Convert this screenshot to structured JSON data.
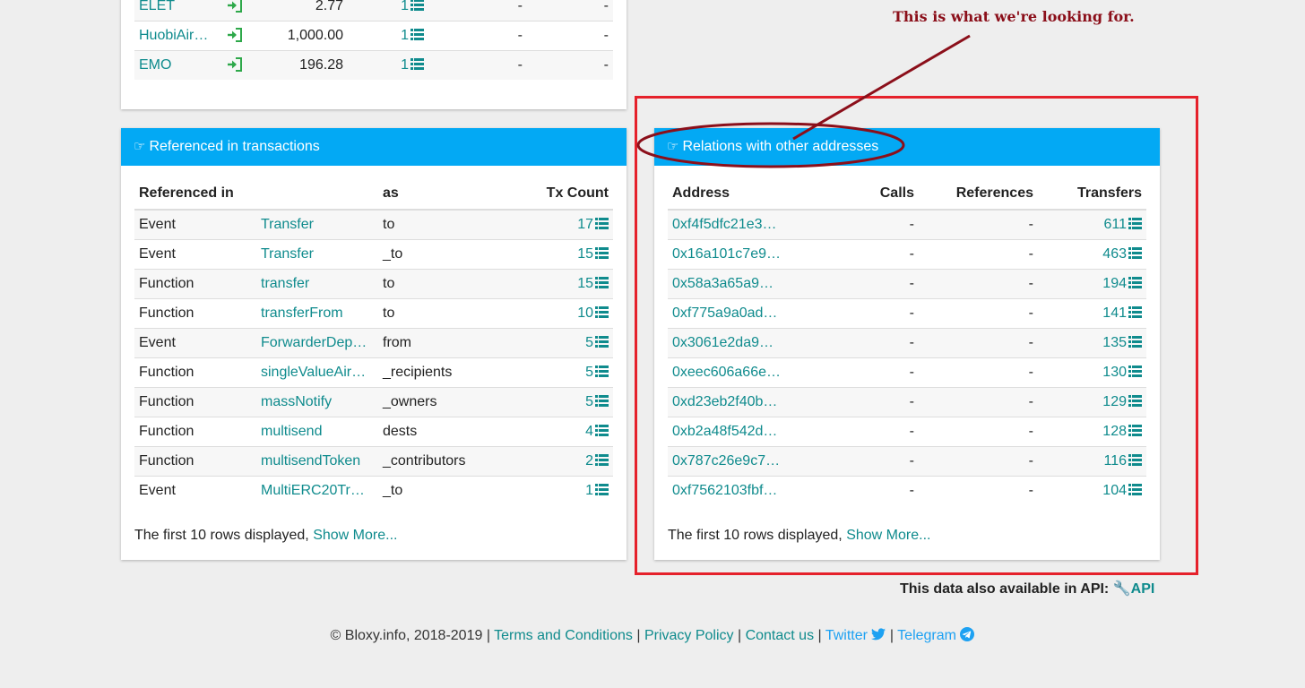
{
  "top_table": {
    "rows": [
      {
        "name": "ELET",
        "amount": "2.77",
        "count": "1",
        "c4": "-",
        "c5": "-"
      },
      {
        "name": "HuobiAir…",
        "amount": "1,000.00",
        "count": "1",
        "c4": "-",
        "c5": "-"
      },
      {
        "name": "EMO",
        "amount": "196.28",
        "count": "1",
        "c4": "-",
        "c5": "-"
      }
    ]
  },
  "referenced": {
    "title": "Referenced in transactions",
    "headers": {
      "ref": "Referenced in",
      "as": "as",
      "count": "Tx Count"
    },
    "rows": [
      {
        "type": "Event",
        "name": "Transfer",
        "as": "to",
        "count": "17"
      },
      {
        "type": "Event",
        "name": "Transfer",
        "as": "_to",
        "count": "15"
      },
      {
        "type": "Function",
        "name": "transfer",
        "as": "to",
        "count": "15"
      },
      {
        "type": "Function",
        "name": "transferFrom",
        "as": "to",
        "count": "10"
      },
      {
        "type": "Event",
        "name": "ForwarderDep…",
        "as": "from",
        "count": "5"
      },
      {
        "type": "Function",
        "name": "singleValueAir…",
        "as": "_recipients",
        "count": "5"
      },
      {
        "type": "Function",
        "name": "massNotify",
        "as": "_owners",
        "count": "5"
      },
      {
        "type": "Function",
        "name": "multisend",
        "as": "dests",
        "count": "4"
      },
      {
        "type": "Function",
        "name": "multisendToken",
        "as": "_contributors",
        "count": "2"
      },
      {
        "type": "Event",
        "name": "MultiERC20Tr…",
        "as": "_to",
        "count": "1"
      }
    ],
    "footer_text": "The first 10 rows displayed,",
    "show_more": "Show More..."
  },
  "relations": {
    "title": "Relations with other addresses",
    "headers": {
      "address": "Address",
      "calls": "Calls",
      "references": "References",
      "transfers": "Transfers"
    },
    "rows": [
      {
        "address": "0xf4f5dfc21e3…",
        "calls": "-",
        "references": "-",
        "transfers": "611"
      },
      {
        "address": "0x16a101c7e9…",
        "calls": "-",
        "references": "-",
        "transfers": "463"
      },
      {
        "address": "0x58a3a65a9…",
        "calls": "-",
        "references": "-",
        "transfers": "194"
      },
      {
        "address": "0xf775a9a0ad…",
        "calls": "-",
        "references": "-",
        "transfers": "141"
      },
      {
        "address": "0x3061e2da9…",
        "calls": "-",
        "references": "-",
        "transfers": "135"
      },
      {
        "address": "0xeec606a66e…",
        "calls": "-",
        "references": "-",
        "transfers": "130"
      },
      {
        "address": "0xd23eb2f40b…",
        "calls": "-",
        "references": "-",
        "transfers": "129"
      },
      {
        "address": "0xb2a48f542d…",
        "calls": "-",
        "references": "-",
        "transfers": "128"
      },
      {
        "address": "0x787c26e9c7…",
        "calls": "-",
        "references": "-",
        "transfers": "116"
      },
      {
        "address": "0xf7562103fbf…",
        "calls": "-",
        "references": "-",
        "transfers": "104"
      }
    ],
    "footer_text": "The first 10 rows displayed,",
    "show_more": "Show More..."
  },
  "api": {
    "text": "This data also available in API:",
    "link": "API"
  },
  "footer": {
    "copyright": "© Bloxy.info, 2018-2019 |",
    "terms": "Terms and Conditions",
    "privacy": "Privacy Policy",
    "contact": "Contact us",
    "twitter": "Twitter",
    "telegram": "Telegram",
    "sep": "|"
  },
  "annotation": {
    "text": "This is what we're looking for.",
    "color": "#8b0f1a",
    "highlight_color": "#e5212b"
  },
  "colors": {
    "header_blue": "#03a9f4",
    "link_teal": "#0f8b8d",
    "enter_green": "#2ea84a"
  }
}
